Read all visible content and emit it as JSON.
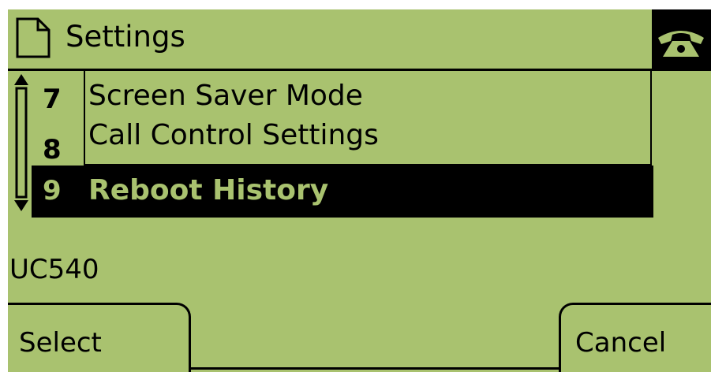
{
  "header": {
    "title": "Settings",
    "doc_icon": "document-icon",
    "phone_icon": "phone-handset-icon"
  },
  "menu": {
    "items": [
      {
        "num": "7",
        "label": "Screen Saver Mode",
        "selected": false
      },
      {
        "num": "8",
        "label": "Call Control Settings",
        "selected": false
      },
      {
        "num": "9",
        "label": "Reboot History",
        "selected": true
      }
    ],
    "scroll_icon": "scroll-indicator-icon"
  },
  "status": {
    "model": "UC540"
  },
  "softkeys": {
    "left": "Select",
    "right": "Cancel"
  },
  "colors": {
    "lcd_background": "#a9c26f",
    "foreground": "#000000"
  }
}
